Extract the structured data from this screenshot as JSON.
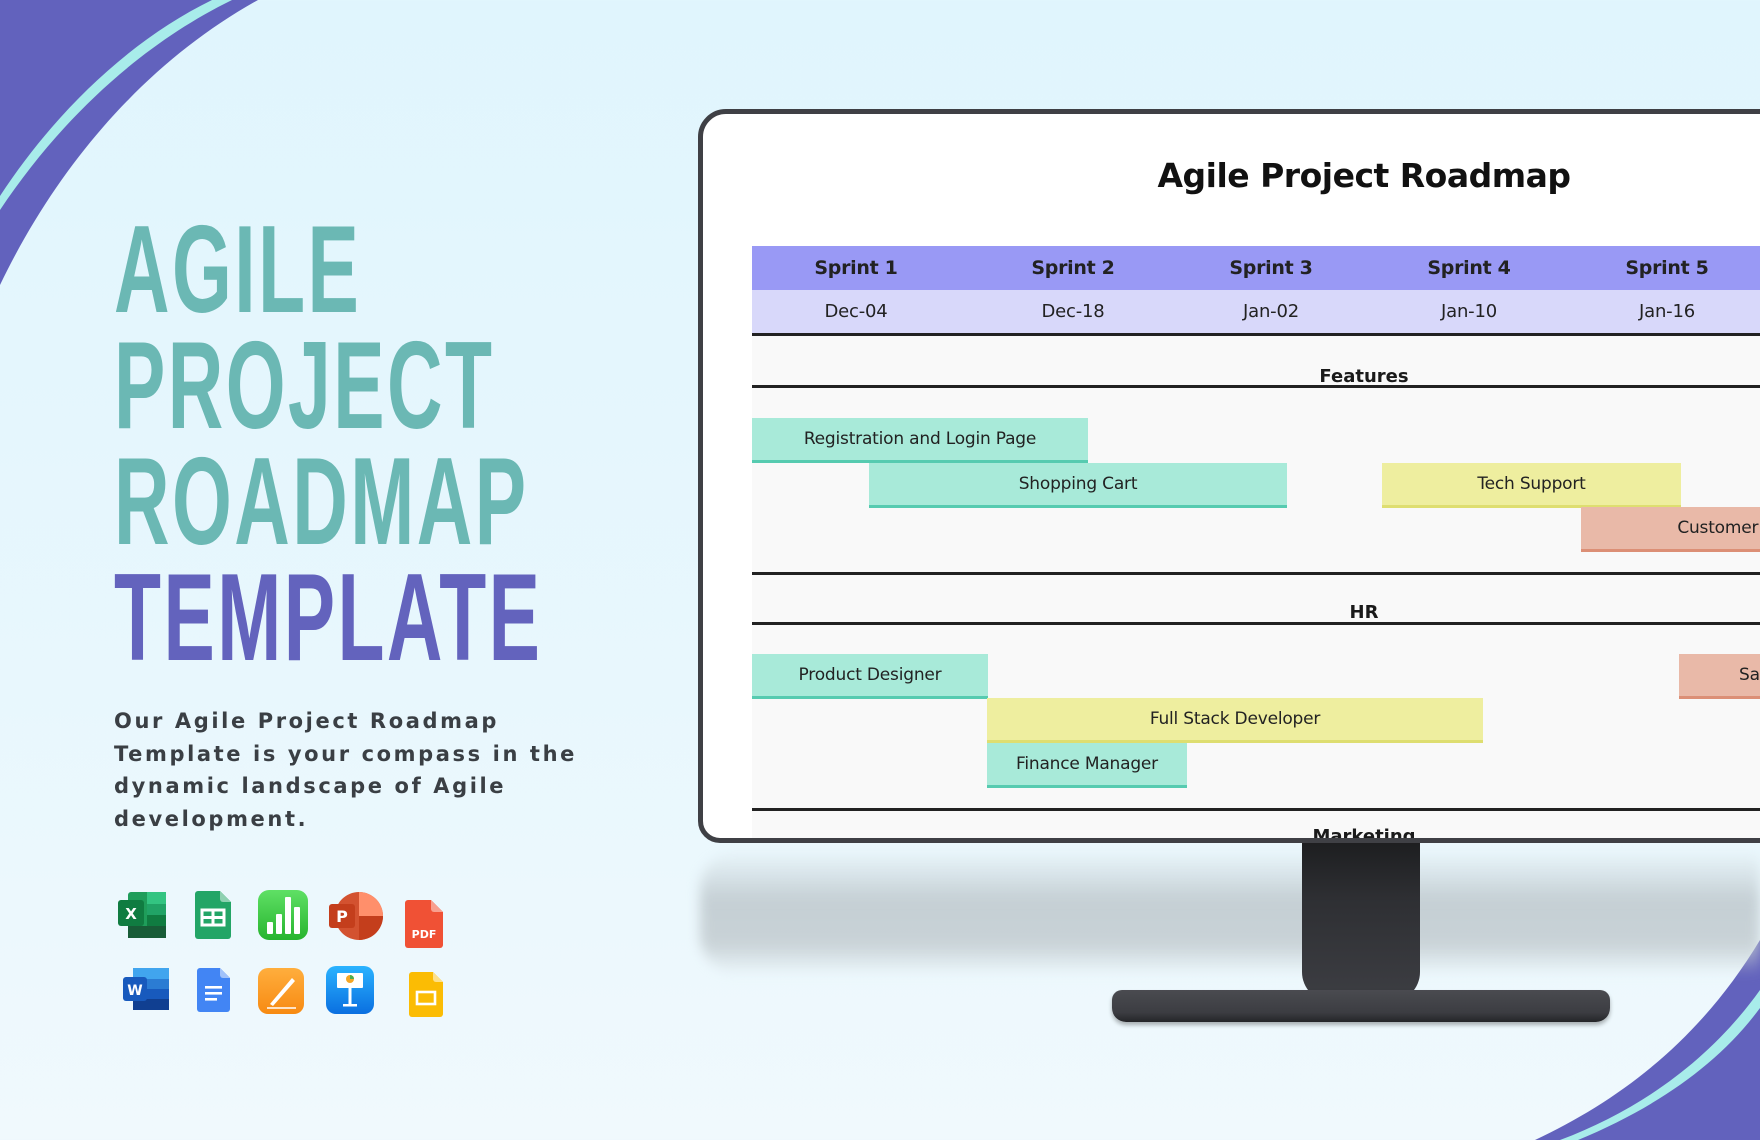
{
  "hero": {
    "title_lines": [
      "AGILE",
      "PROJECT",
      "ROADMAP",
      "TEMPLATE"
    ],
    "description": "Our Agile Project Roadmap Template is your compass in the dynamic landscape of Agile development."
  },
  "colors": {
    "teal": "#6bb8b4",
    "purple": "#6363bd",
    "accent_cyan": "#a6ecec",
    "sprint_header": "#9999f5",
    "date_row": "#d8d8fa",
    "bar_green": "#a8ead9",
    "bar_yellow": "#eeee9f",
    "bar_salmon": "#e9b9a8"
  },
  "format_icons": {
    "row1": [
      "excel-icon",
      "google-sheets-icon",
      "numbers-icon",
      "powerpoint-icon",
      "pdf-icon"
    ],
    "row2": [
      "word-icon",
      "google-docs-icon",
      "pages-icon",
      "keynote-icon",
      "google-slides-icon"
    ],
    "pdf_label": "PDF",
    "excel_letter": "X",
    "powerpoint_letter": "P",
    "word_letter": "W"
  },
  "roadmap": {
    "title": "Agile Project Roadmap",
    "sprints": [
      {
        "name": "Sprint 1",
        "date": "Dec-04"
      },
      {
        "name": "Sprint 2",
        "date": "Dec-18"
      },
      {
        "name": "Sprint 3",
        "date": "Jan-02"
      },
      {
        "name": "Sprint 4",
        "date": "Jan-10"
      },
      {
        "name": "Sprint 5",
        "date": "Jan-16"
      }
    ],
    "sections": [
      {
        "label": "Features",
        "tasks": [
          {
            "label": "Registration and Login Page",
            "color": "green"
          },
          {
            "label": "Shopping Cart",
            "color": "green"
          },
          {
            "label": "Tech Support",
            "color": "yellow"
          },
          {
            "label": "Customer Su",
            "color": "salmon"
          }
        ]
      },
      {
        "label": "HR",
        "tasks": [
          {
            "label": "Product Designer",
            "color": "green"
          },
          {
            "label": "Full Stack Developer",
            "color": "yellow"
          },
          {
            "label": "Finance Manager",
            "color": "green"
          },
          {
            "label": "Sa",
            "color": "salmon"
          }
        ]
      },
      {
        "label": "Marketing",
        "tasks": []
      }
    ]
  }
}
